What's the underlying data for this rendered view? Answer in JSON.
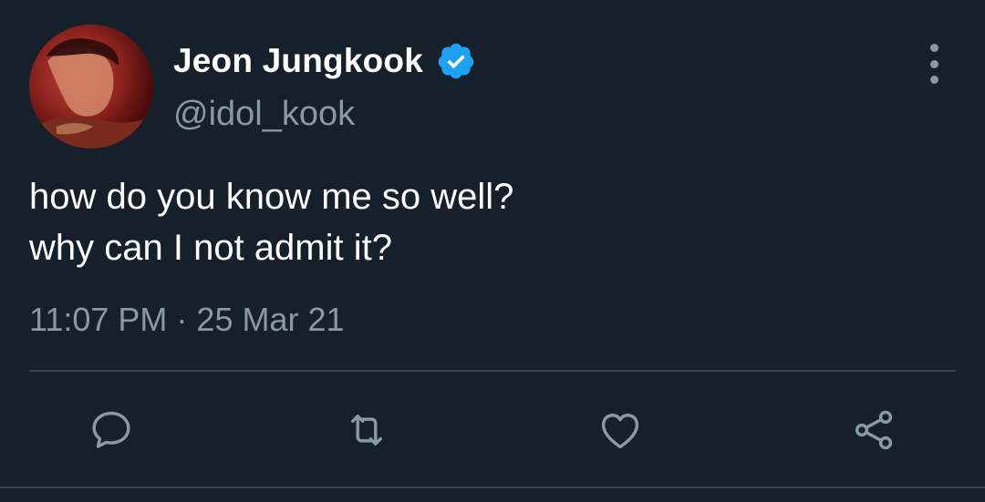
{
  "author": {
    "name": "Jeon Jungkook",
    "handle": "@idol_kook",
    "verified": true,
    "avatar_icon": "profile-photo"
  },
  "tweet": {
    "lines": [
      "how do you know me so well?",
      "why can I not admit it?"
    ],
    "time": "11:07 PM",
    "separator": "·",
    "date": "25 Mar 21"
  },
  "actions": [
    {
      "name": "reply",
      "icon": "comment-icon"
    },
    {
      "name": "retweet",
      "icon": "retweet-icon"
    },
    {
      "name": "like",
      "icon": "heart-icon"
    },
    {
      "name": "share",
      "icon": "share-icon"
    }
  ],
  "colors": {
    "background": "#15202b",
    "text_primary": "#ffffff",
    "text_secondary": "#8899a6",
    "verified_blue": "#1da1f2",
    "divider": "#38444d"
  }
}
